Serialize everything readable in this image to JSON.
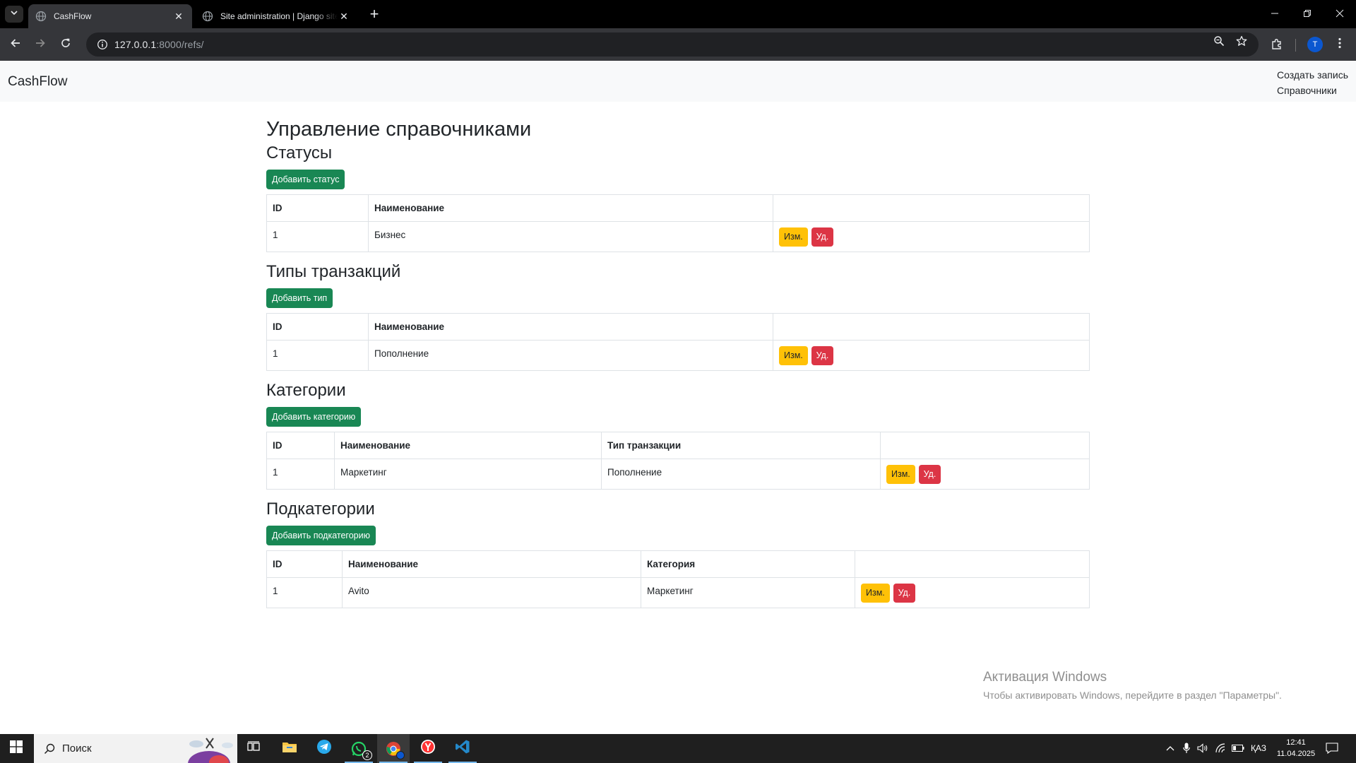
{
  "browser": {
    "tabs": [
      {
        "title": "CashFlow",
        "active": true
      },
      {
        "title": "Site administration | Django site admin",
        "active": false
      }
    ],
    "address": {
      "host": "127.0.0.1",
      "port_path": ":8000/refs/"
    },
    "profile_initial": "T"
  },
  "navbar": {
    "brand": "CashFlow",
    "links": [
      "Создать запись",
      "Справочники"
    ]
  },
  "page": {
    "title": "Управление справочниками",
    "row_actions": {
      "edit": "Изм.",
      "delete": "Уд."
    },
    "sections": [
      {
        "title": "Статусы",
        "add_button": "Добавить статус",
        "columns": [
          "ID",
          "Наименование",
          ""
        ],
        "rows": [
          [
            "1",
            "Бизнес"
          ]
        ]
      },
      {
        "title": "Типы транзакций",
        "add_button": "Добавить тип",
        "columns": [
          "ID",
          "Наименование",
          ""
        ],
        "rows": [
          [
            "1",
            "Пополнение"
          ]
        ]
      },
      {
        "title": "Категории",
        "add_button": "Добавить категорию",
        "columns": [
          "ID",
          "Наименование",
          "Тип транзакции",
          ""
        ],
        "rows": [
          [
            "1",
            "Маркетинг",
            "Пополнение"
          ]
        ]
      },
      {
        "title": "Подкатегории",
        "add_button": "Добавить подкатегорию",
        "columns": [
          "ID",
          "Наименование",
          "Категория",
          ""
        ],
        "rows": [
          [
            "1",
            "Avito",
            "Маркетинг"
          ]
        ]
      }
    ]
  },
  "watermark": {
    "title": "Активация Windows",
    "subtitle": "Чтобы активировать Windows, перейдите в раздел \"Параметры\"."
  },
  "taskbar": {
    "search_placeholder": "Поиск",
    "whatsapp_badge": "2",
    "language": "ҚАЗ",
    "time": "12:41",
    "date": "11.04.2025"
  },
  "colors": {
    "success": "#198754",
    "warning": "#ffc107",
    "danger": "#dc3545"
  }
}
